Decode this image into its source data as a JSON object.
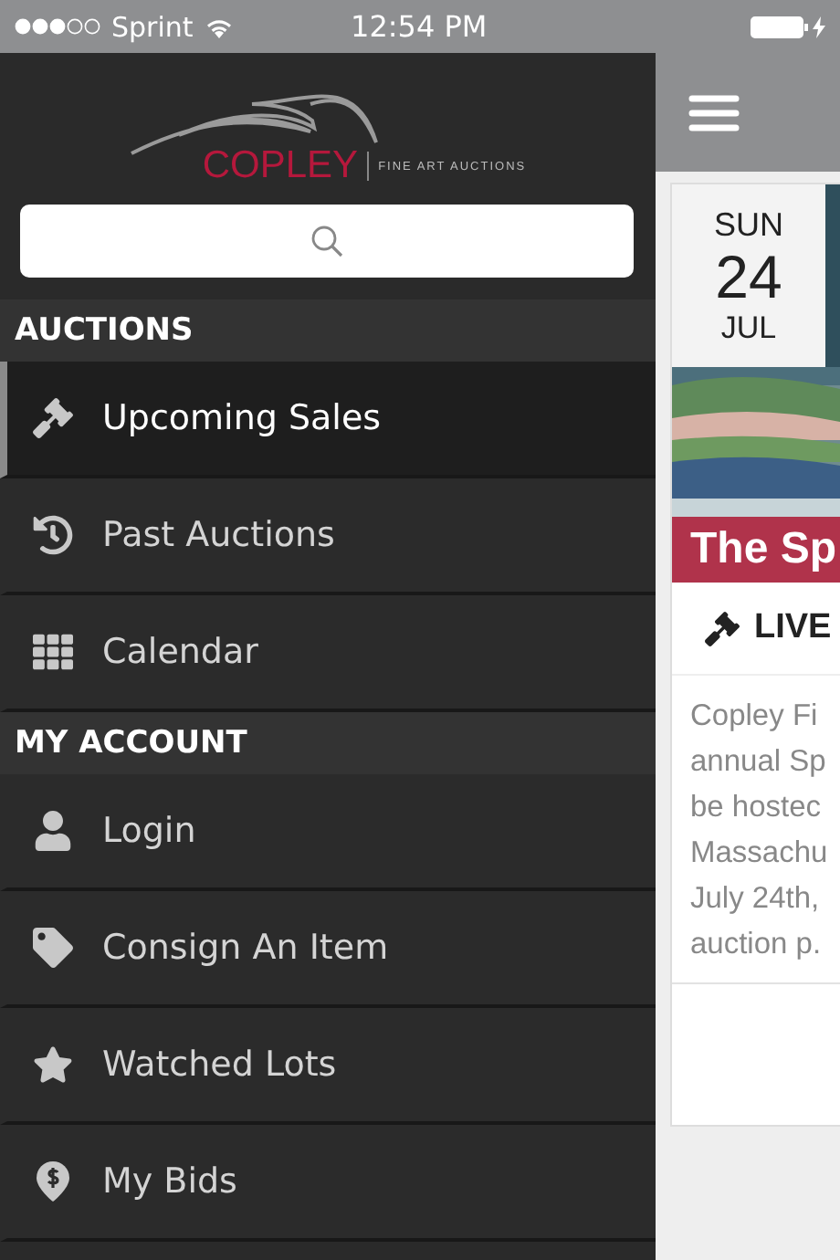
{
  "status_bar": {
    "carrier": "Sprint",
    "time": "12:54 PM"
  },
  "logo": {
    "name": "COPLEY",
    "tagline": "FINE ART AUCTIONS"
  },
  "sections": [
    {
      "title": "AUCTIONS",
      "items": [
        {
          "label": "Upcoming Sales",
          "selected": true
        },
        {
          "label": "Past Auctions",
          "selected": false
        },
        {
          "label": "Calendar",
          "selected": false
        }
      ]
    },
    {
      "title": "MY ACCOUNT",
      "items": [
        {
          "label": "Login",
          "selected": false
        },
        {
          "label": "Consign An Item",
          "selected": false
        },
        {
          "label": "Watched Lots",
          "selected": false
        },
        {
          "label": "My Bids",
          "selected": false
        }
      ]
    }
  ],
  "auction_card": {
    "weekday": "SUN",
    "day": "24",
    "month": "JUL",
    "title": "The Sp",
    "badge": "LIVE",
    "description_lines": [
      "Copley Fi",
      "annual Sp",
      "be hostec",
      "Massachu",
      "July 24th,",
      "auction p."
    ]
  }
}
